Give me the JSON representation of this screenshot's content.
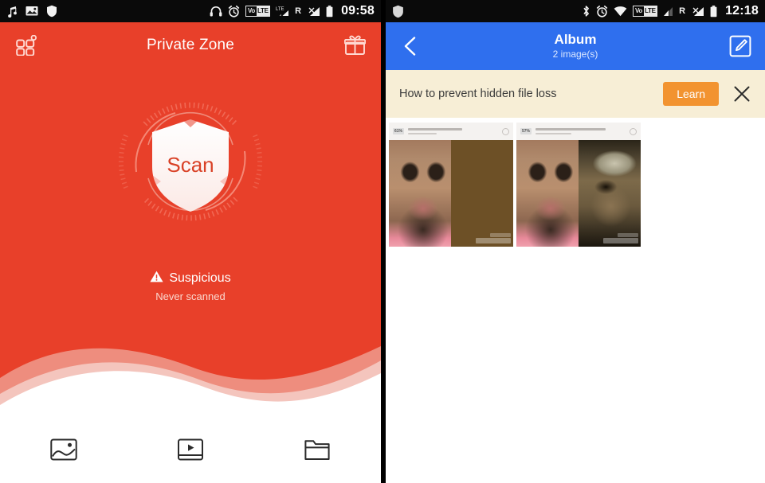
{
  "left_phone": {
    "statusbar": {
      "left_icons": [
        "music-note-icon",
        "photo-icon",
        "shield-icon"
      ],
      "right_icons": [
        "headphones-icon",
        "alarm-icon",
        "volte-icon",
        "lte-signal-icon",
        "roaming-icon",
        "signal-icon",
        "battery-icon"
      ],
      "volte_prefix": "Vo",
      "volte_suffix": "LTE",
      "roaming_label": "R",
      "clock": "09:58"
    },
    "header": {
      "menu_icon": "grid-apps-icon",
      "title": "Private Zone",
      "gift_icon": "gift-icon"
    },
    "scan": {
      "button_label": "Scan",
      "shield_icon": "shield-scan-icon",
      "ring_icon": "scan-ring-icon"
    },
    "status": {
      "warning_icon": "warning-triangle-icon",
      "main": "Suspicious",
      "sub": "Never scanned"
    },
    "bottom_nav": [
      {
        "icon": "image-icon",
        "label": ""
      },
      {
        "icon": "video-icon",
        "label": ""
      },
      {
        "icon": "folder-icon",
        "label": ""
      }
    ],
    "colors": {
      "background": "#e8402a",
      "wave_light": "#f0a79b",
      "wave_lighter": "#f5cfc8",
      "text": "#ffffff",
      "subtext": "#fbd8cf"
    }
  },
  "right_phone": {
    "statusbar": {
      "left_icons": [
        "shield-icon"
      ],
      "right_icons": [
        "bluetooth-icon",
        "alarm-icon",
        "wifi-icon",
        "volte-icon",
        "signal-icon",
        "roaming-icon",
        "signal2-icon",
        "battery-icon"
      ],
      "volte_prefix": "Vo",
      "volte_suffix": "LTE",
      "roaming_label": "R",
      "clock": "12:18"
    },
    "header": {
      "back_icon": "back-chevron-icon",
      "title": "Album",
      "subtitle": "2 image(s)",
      "edit_icon": "edit-pencil-icon"
    },
    "banner": {
      "text": "How to prevent hidden file loss",
      "action_label": "Learn",
      "close_icon": "close-x-icon"
    },
    "thumbnails": [
      {
        "name": "album-thumbnail-1",
        "badge": "61%",
        "left_face": "selfie-photo",
        "right_face": "renaissance-painting"
      },
      {
        "name": "album-thumbnail-2",
        "badge": "57%",
        "left_face": "selfie-photo",
        "right_face": "portrait-painting"
      }
    ],
    "colors": {
      "header": "#2f6fee",
      "banner_bg": "#f7eed6",
      "learn_button": "#f29330",
      "background": "#ffffff"
    }
  }
}
